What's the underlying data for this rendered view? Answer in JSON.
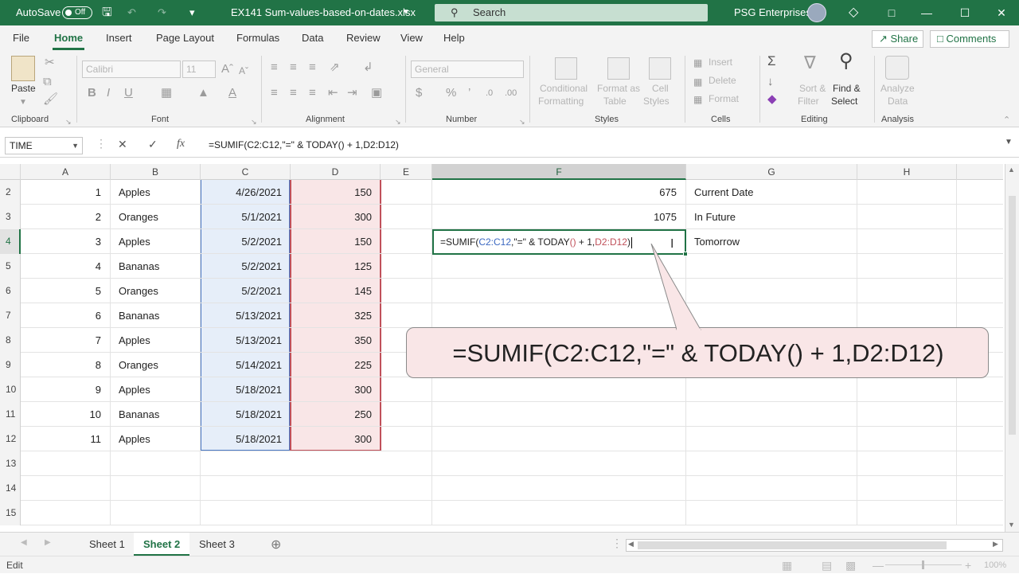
{
  "titlebar": {
    "autosave_label": "AutoSave",
    "autosave_state": "Off",
    "filename": "EX141 Sum-values-based-on-dates.xlsx",
    "search_placeholder": "Search",
    "account_name": "PSG Enterprises"
  },
  "menu": {
    "tabs": [
      "File",
      "Home",
      "Insert",
      "Page Layout",
      "Formulas",
      "Data",
      "Review",
      "View",
      "Help"
    ],
    "active_tab": "Home",
    "share_label": "Share",
    "comments_label": "Comments"
  },
  "ribbon": {
    "clipboard": {
      "paste": "Paste",
      "group": "Clipboard"
    },
    "font": {
      "family": "Calibri",
      "size": "11",
      "group": "Font"
    },
    "alignment": {
      "group": "Alignment"
    },
    "number": {
      "format": "General",
      "group": "Number"
    },
    "styles": {
      "conditional": "Conditional",
      "formatting": "Formatting",
      "format_as": "Format as",
      "table": "Table",
      "cell": "Cell",
      "cell_styles": "Styles",
      "group": "Styles"
    },
    "cells": {
      "insert": "Insert",
      "delete": "Delete",
      "format": "Format",
      "group": "Cells"
    },
    "editing": {
      "sort": "Sort &",
      "filter": "Filter",
      "find": "Find &",
      "select": "Select",
      "group": "Editing"
    },
    "analysis": {
      "analyze": "Analyze",
      "data": "Data",
      "group": "Analysis"
    }
  },
  "formula_bar": {
    "name_box": "TIME",
    "formula": "=SUMIF(C2:C12,\"=\" & TODAY() + 1,D2:D12)"
  },
  "columns": [
    "A",
    "B",
    "C",
    "D",
    "E",
    "F",
    "G",
    "H"
  ],
  "rows": [
    {
      "num": "2",
      "a": "1",
      "b": "Apples",
      "c": "4/26/2021",
      "d": "150",
      "f": "675",
      "g": "Current Date"
    },
    {
      "num": "3",
      "a": "2",
      "b": "Oranges",
      "c": "5/1/2021",
      "d": "300",
      "f": "1075",
      "g": "In Future"
    },
    {
      "num": "4",
      "a": "3",
      "b": "Apples",
      "c": "5/2/2021",
      "d": "150",
      "f": "",
      "g": "Tomorrow"
    },
    {
      "num": "5",
      "a": "4",
      "b": "Bananas",
      "c": "5/2/2021",
      "d": "125",
      "f": "",
      "g": ""
    },
    {
      "num": "6",
      "a": "5",
      "b": "Oranges",
      "c": "5/2/2021",
      "d": "145",
      "f": "",
      "g": ""
    },
    {
      "num": "7",
      "a": "6",
      "b": "Bananas",
      "c": "5/13/2021",
      "d": "325",
      "f": "",
      "g": ""
    },
    {
      "num": "8",
      "a": "7",
      "b": "Apples",
      "c": "5/13/2021",
      "d": "350",
      "f": "",
      "g": ""
    },
    {
      "num": "9",
      "a": "8",
      "b": "Oranges",
      "c": "5/14/2021",
      "d": "225",
      "f": "",
      "g": ""
    },
    {
      "num": "10",
      "a": "9",
      "b": "Apples",
      "c": "5/18/2021",
      "d": "300",
      "f": "",
      "g": ""
    },
    {
      "num": "11",
      "a": "10",
      "b": "Bananas",
      "c": "5/18/2021",
      "d": "250",
      "f": "",
      "g": ""
    },
    {
      "num": "12",
      "a": "11",
      "b": "Apples",
      "c": "5/18/2021",
      "d": "300",
      "f": "",
      "g": ""
    },
    {
      "num": "13",
      "a": "",
      "b": "",
      "c": "",
      "d": "",
      "f": "",
      "g": ""
    },
    {
      "num": "14",
      "a": "",
      "b": "",
      "c": "",
      "d": "",
      "f": "",
      "g": ""
    },
    {
      "num": "15",
      "a": "",
      "b": "",
      "c": "",
      "d": "",
      "f": "",
      "g": ""
    }
  ],
  "edit_cell": {
    "p1": "=SUMIF(",
    "p2": "C2:C12",
    "p3": ",\"=\" & TODAY",
    "p4": "()",
    "p5": " + 1,",
    "p6": "D2:D12",
    "p7": ")"
  },
  "callout": {
    "text": "=SUMIF(C2:C12,\"=\" & TODAY() + 1,D2:D12)"
  },
  "sheets": {
    "tabs": [
      "Sheet 1",
      "Sheet 2",
      "Sheet 3"
    ],
    "active": "Sheet 2"
  },
  "status": {
    "mode": "Edit",
    "zoom": "100%"
  },
  "colors": {
    "accent": "#217346",
    "range_c": "#4a78c4",
    "range_d": "#c0505a"
  }
}
